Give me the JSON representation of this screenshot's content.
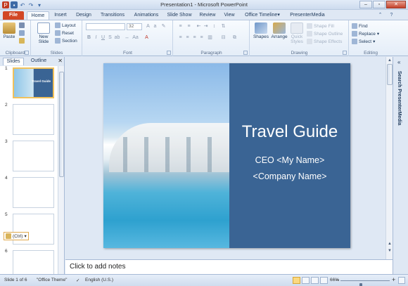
{
  "titlebar": {
    "title": "Presentation1 - Microsoft PowerPoint"
  },
  "tabs": [
    "File",
    "Home",
    "Insert",
    "Design",
    "Transitions",
    "Animations",
    "Slide Show",
    "Review",
    "View",
    "Office Timeline▾",
    "PresenterMedia"
  ],
  "ribbon": {
    "clipboard": {
      "label": "Clipboard",
      "paste": "Paste"
    },
    "slides": {
      "label": "Slides",
      "new_slide": "New Slide",
      "layout": "Layout",
      "reset": "Reset",
      "section": "Section"
    },
    "font": {
      "label": "Font",
      "size": "32"
    },
    "paragraph": {
      "label": "Paragraph"
    },
    "drawing": {
      "label": "Drawing",
      "shapes": "Shapes",
      "arrange": "Arrange",
      "quick_styles": "Quick Styles",
      "shape_fill": "Shape Fill",
      "shape_outline": "Shape Outline",
      "shape_effects": "Shape Effects"
    },
    "editing": {
      "label": "Editing",
      "find": "Find",
      "replace": "Replace",
      "select": "Select"
    }
  },
  "pane": {
    "tabs": [
      "Slides",
      "Outline"
    ],
    "slide_numbers": [
      "1",
      "2",
      "3",
      "4",
      "5",
      "6"
    ],
    "ctrl_paste": "(Ctrl)"
  },
  "slide": {
    "title": "Travel Guide",
    "subtitle_line1": "CEO <My Name>",
    "subtitle_line2": "<Company Name>"
  },
  "thumb_title": "Travel Guide",
  "side_panel": {
    "label": "Search PresenterMedia"
  },
  "notes": {
    "placeholder": "Click to add notes"
  },
  "status": {
    "slide": "Slide 1 of 6",
    "theme": "\"Office Theme\"",
    "language": "English (U.S.)",
    "zoom": "66%",
    "zoom_fraction": 0.42
  }
}
